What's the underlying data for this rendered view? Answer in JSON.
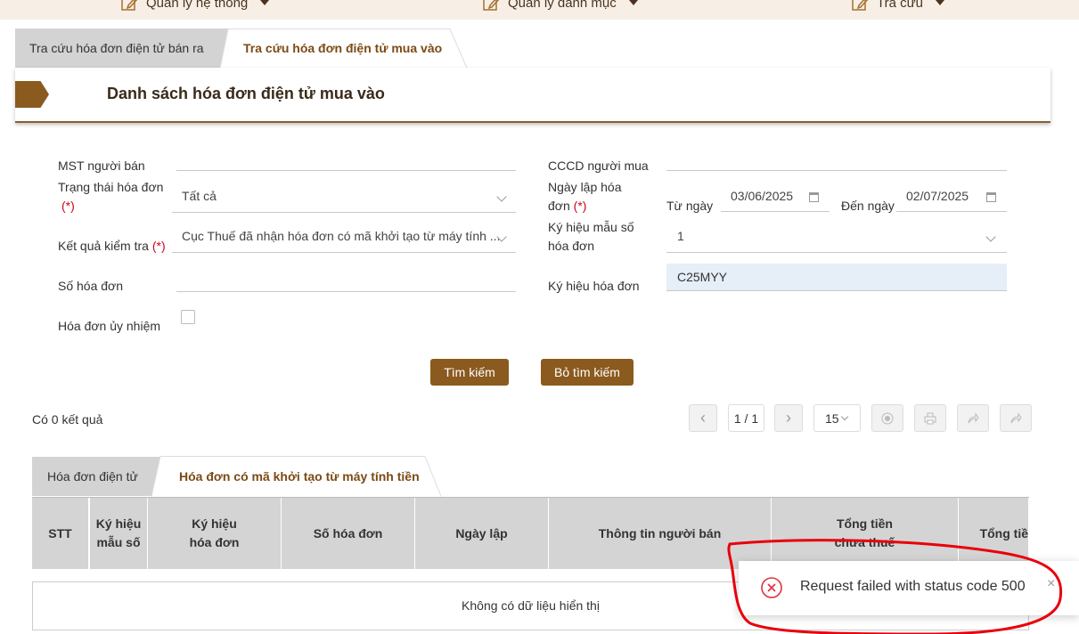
{
  "nav": {
    "items": [
      {
        "label": "Quản lý hệ thống",
        "icon": "edit-icon"
      },
      {
        "label": "Quản lý danh mục",
        "icon": "edit-icon"
      },
      {
        "label": "Tra cứu",
        "icon": "edit-icon"
      }
    ]
  },
  "tabs": [
    "Tra cứu hóa đơn điện tử bán ra",
    "Tra cứu hóa đơn điện tử mua vào"
  ],
  "page_title": "Danh sách hóa đơn điện tử mua vào",
  "form": {
    "mst_seller_label": "MST người bán",
    "mst_seller_value": "",
    "cccd_buyer_label": "CCCD người mua",
    "cccd_buyer_value": "",
    "status_label": "Trạng thái hóa đơn",
    "status_value": "Tất cả",
    "date_label_line1": "Ngày lập hóa",
    "date_label_line2": "đơn",
    "from_label": "Từ ngày",
    "from_value": "03/06/2025",
    "to_label": "Đến ngày",
    "to_value": "02/07/2025",
    "check_result_label": "Kết quả kiểm tra",
    "check_result_value": "Cục Thuế đã nhận hóa đơn có mã khởi tạo từ máy tính ...",
    "template_symbol_label_line1": "Ký hiệu mẫu số",
    "template_symbol_label_line2": "hóa đơn",
    "template_symbol_value": "1",
    "invoice_number_label": "Số hóa đơn",
    "invoice_number_value": "",
    "invoice_symbol_label": "Ký hiệu hóa đơn",
    "invoice_symbol_value": "C25MYY",
    "authorized_label": "Hóa đơn ủy nhiệm",
    "required_mark": "(*)"
  },
  "buttons": {
    "search": "Tìm kiếm",
    "clear": "Bỏ tìm kiếm"
  },
  "results": {
    "count_text": "Có 0 kết quả",
    "page_text": "1 / 1",
    "page_size": "15"
  },
  "subtabs": [
    "Hóa đơn điện tử",
    "Hóa đơn có mã khởi tạo từ máy tính tiền"
  ],
  "table": {
    "headers": [
      {
        "l1": "STT",
        "l2": ""
      },
      {
        "l1": "Ký hiệu",
        "l2": "mẫu số"
      },
      {
        "l1": "Ký hiệu",
        "l2": "hóa đơn"
      },
      {
        "l1": "Số hóa đơn",
        "l2": ""
      },
      {
        "l1": "Ngày lập",
        "l2": ""
      },
      {
        "l1": "Thông tin người bán",
        "l2": ""
      },
      {
        "l1": "Tổng tiền",
        "l2": "chưa thuế"
      },
      {
        "l1": "Tổng tiề",
        "l2": ""
      }
    ],
    "empty_text": "Không có dữ liệu hiển thị"
  },
  "toast": {
    "message": "Request failed with status code 500"
  },
  "colors": {
    "brand": "#8b5a1f",
    "tab_active_text": "#7b4a14",
    "required": "#d0021b",
    "annotation": "#e8000b",
    "error": "#e0303a"
  }
}
